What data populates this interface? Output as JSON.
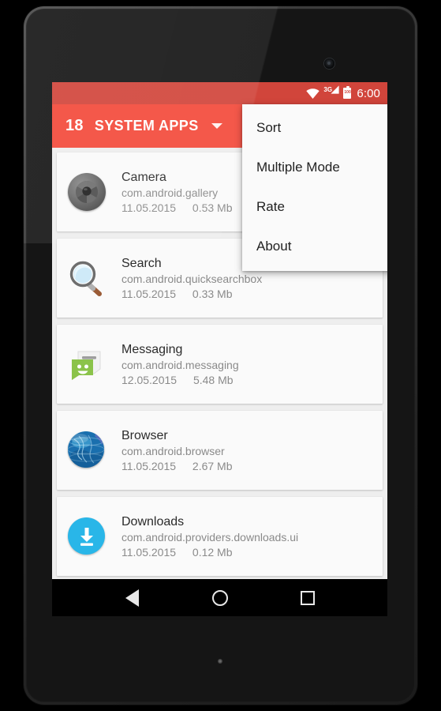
{
  "device": {
    "front_camera_icon": "front-camera",
    "bottom_led_icon": "led-dot"
  },
  "statusbar": {
    "wifi_icon": "wifi-icon",
    "network_label": "3G",
    "signal_icon": "cell-signal-icon",
    "battery_icon": "battery-icon",
    "battery_label": "100",
    "time": "6:00"
  },
  "appbar": {
    "count": "18",
    "title": "SYSTEM APPS",
    "spinner_icon": "chevron-down-icon"
  },
  "menu": {
    "items": [
      {
        "label": "Sort"
      },
      {
        "label": "Multiple Mode"
      },
      {
        "label": "Rate"
      },
      {
        "label": "About"
      }
    ]
  },
  "list": {
    "items": [
      {
        "icon": "camera-icon",
        "name": "Camera",
        "package": "com.android.gallery",
        "date": "11.05.2015",
        "size": "0.53 Mb"
      },
      {
        "icon": "search-icon",
        "name": "Search",
        "package": "com.android.quicksearchbox",
        "date": "11.05.2015",
        "size": "0.33 Mb"
      },
      {
        "icon": "messaging-icon",
        "name": "Messaging",
        "package": "com.android.messaging",
        "date": "12.05.2015",
        "size": "5.48 Mb"
      },
      {
        "icon": "browser-icon",
        "name": "Browser",
        "package": "com.android.browser",
        "date": "11.05.2015",
        "size": "2.67 Mb"
      },
      {
        "icon": "downloads-icon",
        "name": "Downloads",
        "package": "com.android.providers.downloads.ui",
        "date": "11.05.2015",
        "size": "0.12 Mb"
      }
    ]
  },
  "navbar": {
    "back_icon": "back-triangle-icon",
    "home_icon": "home-circle-icon",
    "recents_icon": "recents-square-icon"
  },
  "colors": {
    "statusbar": "#d1453b",
    "appbar": "#f4584a",
    "card": "#fafafa",
    "page_background": "#eeeeee"
  }
}
